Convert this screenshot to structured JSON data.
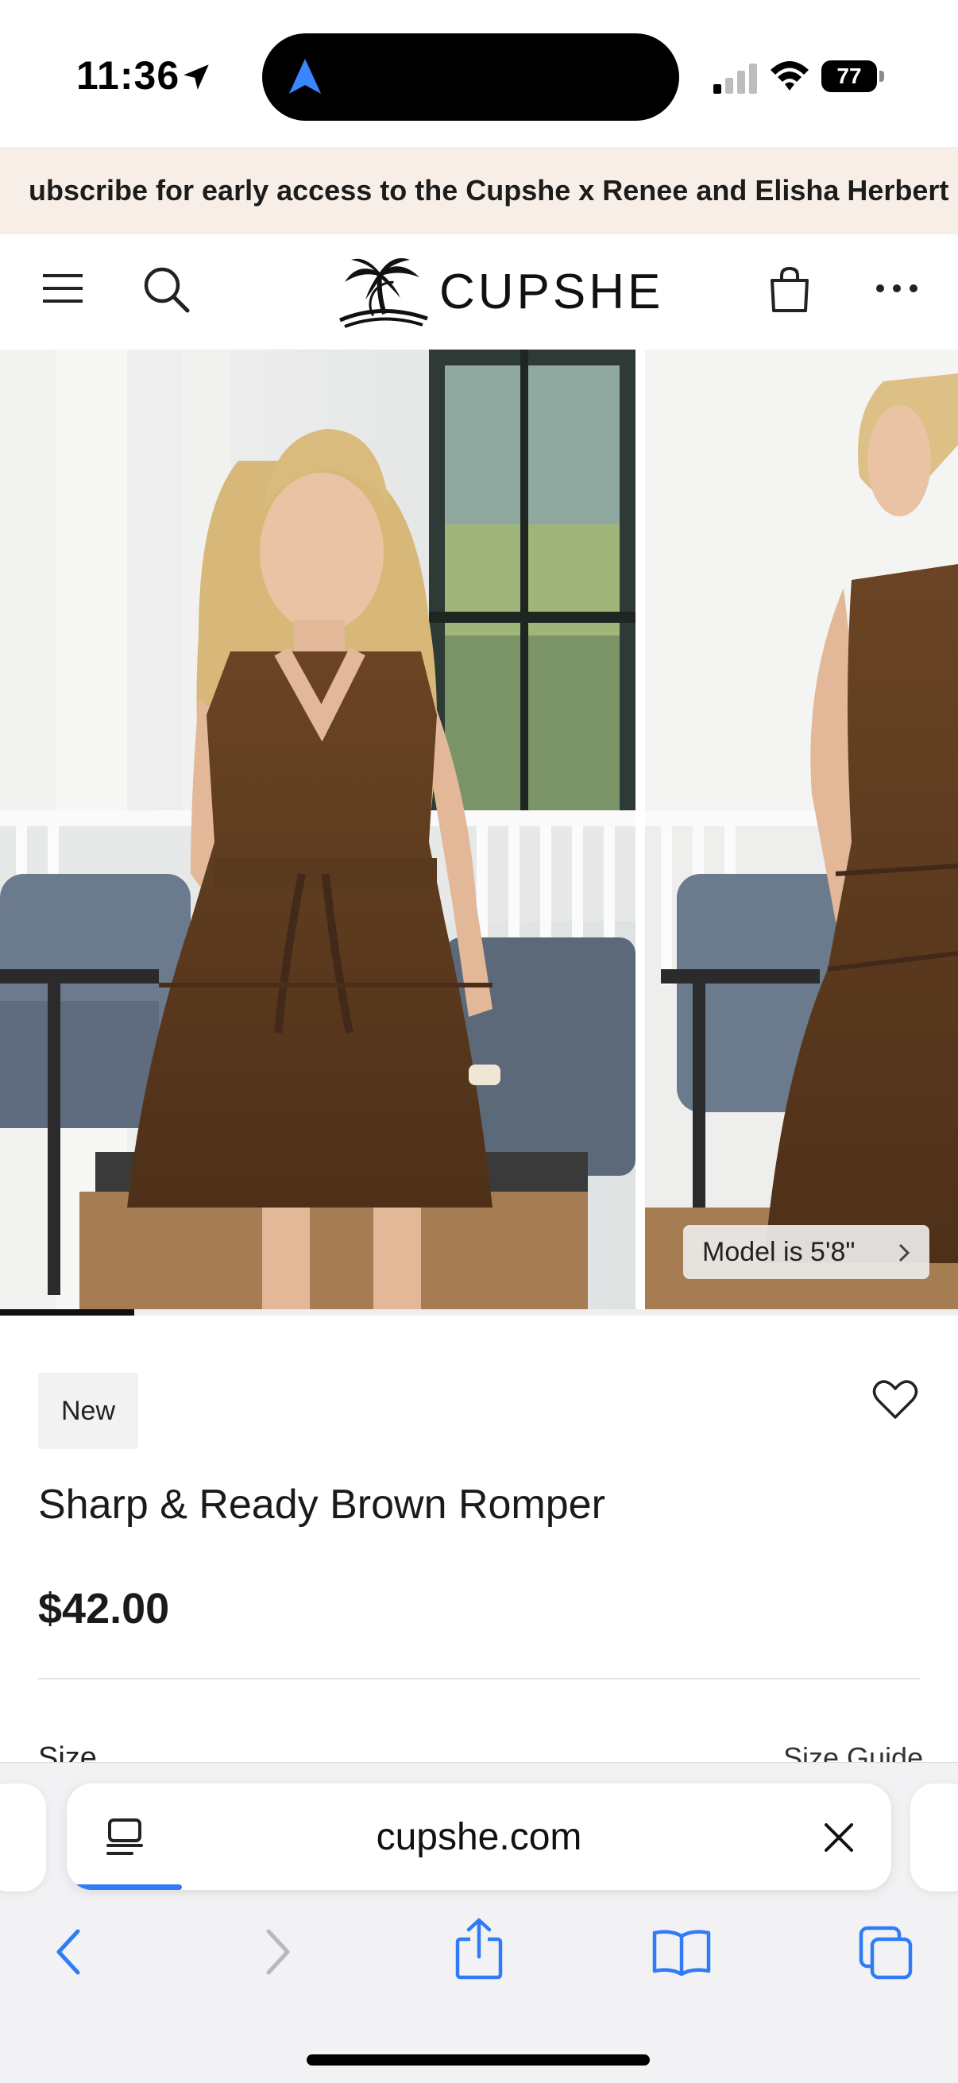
{
  "status_bar": {
    "time": "11:36",
    "battery": "77"
  },
  "promo": {
    "text": "ubscribe for early access to the Cupshe x Renee and Elisha Herbert"
  },
  "header": {
    "brand": "CUPSHE"
  },
  "gallery": {
    "model_button": "Model is 5'8\"",
    "progress": 0.14
  },
  "product": {
    "badge": "New",
    "title": "Sharp & Ready Brown Romper",
    "price": "$42.00",
    "size_label": "Size",
    "size_guide": "Size Guide"
  },
  "browser": {
    "url": "cupshe.com",
    "load_progress": 0.14
  },
  "colors": {
    "promo_bg": "#f7efe7",
    "accent_blue": "#2f7cf6",
    "dress_brown": "#5a3a1e"
  }
}
